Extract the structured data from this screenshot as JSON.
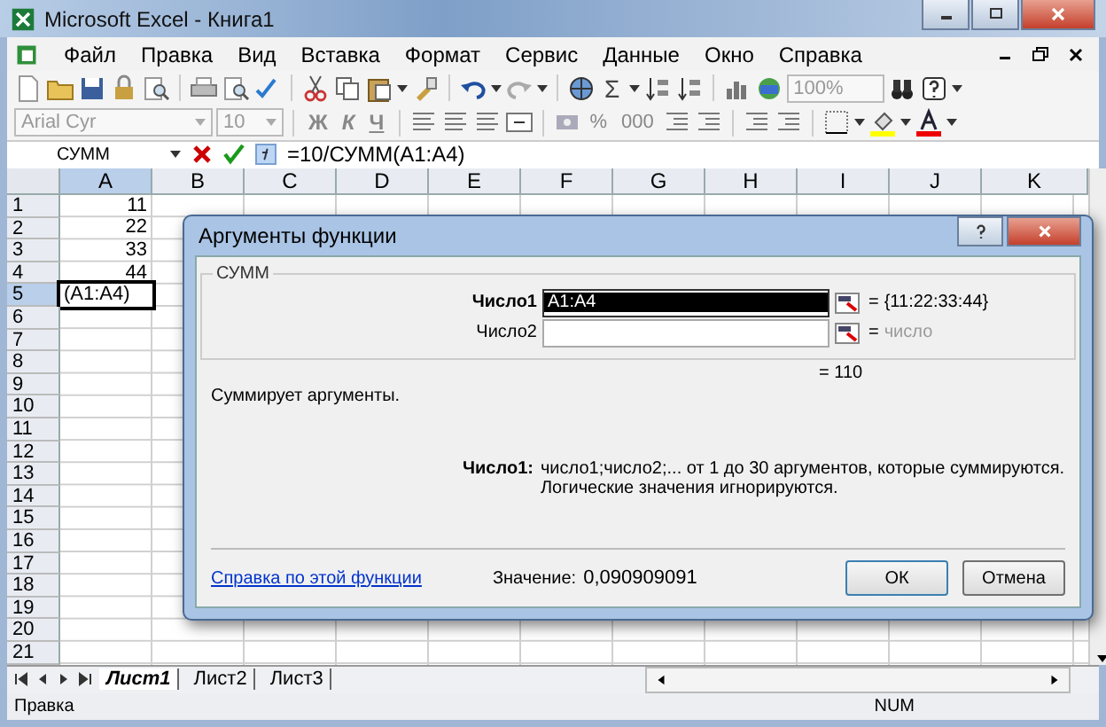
{
  "window": {
    "title": "Microsoft Excel - Книга1"
  },
  "menu": [
    {
      "label": "Файл"
    },
    {
      "label": "Правка"
    },
    {
      "label": "Вид"
    },
    {
      "label": "Вставка"
    },
    {
      "label": "Формат"
    },
    {
      "label": "Сервис"
    },
    {
      "label": "Данные"
    },
    {
      "label": "Окно"
    },
    {
      "label": "Справка"
    }
  ],
  "standard_toolbar": {
    "sum": "Σ",
    "zoom": "100%"
  },
  "format_toolbar": {
    "font": "Arial Cyr",
    "size": "10",
    "style_buttons": [
      "Ж",
      "К",
      "Ч"
    ],
    "number_buttons": [
      "%",
      "000"
    ]
  },
  "formula_bar": {
    "name_box": "СУММ",
    "formula": "=10/СУММ(A1:A4)"
  },
  "sheet": {
    "columns": [
      {
        "label": "A",
        "selected": true
      },
      {
        "label": "B",
        "selected": false
      },
      {
        "label": "C",
        "selected": false
      },
      {
        "label": "D",
        "selected": false
      },
      {
        "label": "E",
        "selected": false
      },
      {
        "label": "F",
        "selected": false
      },
      {
        "label": "G",
        "selected": false
      },
      {
        "label": "H",
        "selected": false
      },
      {
        "label": "I",
        "selected": false
      },
      {
        "label": "J",
        "selected": false
      },
      {
        "label": "K",
        "selected": false
      }
    ],
    "rows": [
      {
        "label": "1",
        "selected": false,
        "cell": {
          "kind": "number",
          "value": "11"
        }
      },
      {
        "label": "2",
        "selected": false,
        "cell": {
          "kind": "number",
          "value": "22"
        }
      },
      {
        "label": "3",
        "selected": false,
        "cell": {
          "kind": "number",
          "value": "33"
        }
      },
      {
        "label": "4",
        "selected": false,
        "cell": {
          "kind": "number",
          "value": "44"
        }
      },
      {
        "label": "5",
        "selected": true,
        "cell": {
          "kind": "edit",
          "value": "(A1:A4)"
        }
      },
      {
        "label": "6",
        "selected": false
      },
      {
        "label": "7",
        "selected": false
      },
      {
        "label": "8",
        "selected": false
      },
      {
        "label": "9",
        "selected": false
      },
      {
        "label": "10",
        "selected": false
      },
      {
        "label": "11",
        "selected": false
      },
      {
        "label": "12",
        "selected": false
      },
      {
        "label": "13",
        "selected": false
      },
      {
        "label": "14",
        "selected": false
      },
      {
        "label": "15",
        "selected": false
      },
      {
        "label": "16",
        "selected": false
      },
      {
        "label": "17",
        "selected": false
      },
      {
        "label": "18",
        "selected": false
      },
      {
        "label": "19",
        "selected": false
      },
      {
        "label": "20",
        "selected": false
      },
      {
        "label": "21",
        "selected": false
      }
    ]
  },
  "sheet_tabs": [
    {
      "label": "Лист1",
      "selected": true
    },
    {
      "label": "Лист2",
      "selected": false
    },
    {
      "label": "Лист3",
      "selected": false
    }
  ],
  "status_bar": {
    "mode": "Правка",
    "num": "NUM"
  },
  "dialog": {
    "title": "Аргументы функции",
    "function": "СУММ",
    "arguments": [
      {
        "label": "Число1",
        "value": "A1:A4",
        "equals": "=",
        "result": "{11:22:33:44}",
        "selected": true
      },
      {
        "label": "Число2",
        "equals": "=",
        "result": "число",
        "selected": false
      }
    ],
    "total": "= 110",
    "description": "Суммирует аргументы.",
    "argument_help": {
      "label": "Число1:",
      "lines": [
        "число1;число2;... от 1 до 30 аргументов, которые суммируются.",
        "Логические значения игнорируются."
      ]
    },
    "help_link": "Справка по этой функции",
    "value_label": "Значение:",
    "value": "0,090909091",
    "buttons": [
      "ОК",
      "Отмена"
    ]
  }
}
